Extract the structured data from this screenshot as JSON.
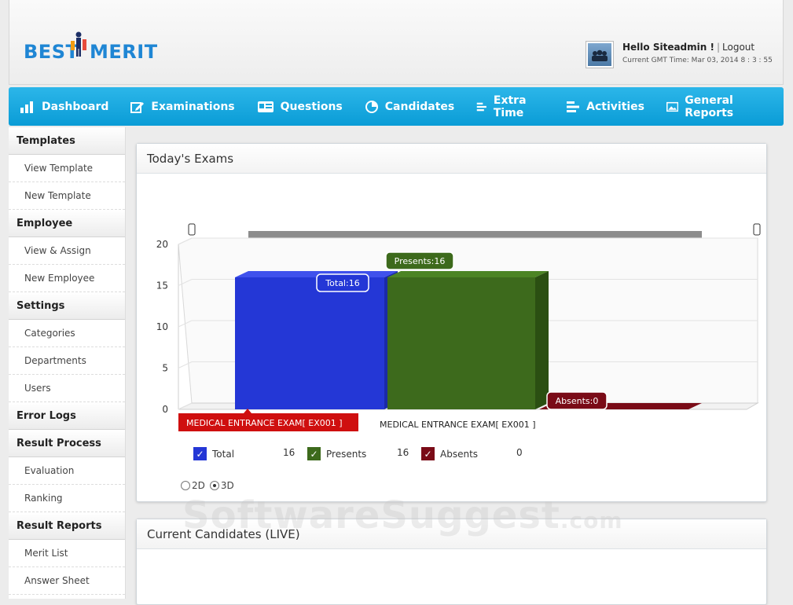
{
  "header": {
    "logo_left": "BEST",
    "logo_right": "MERIT",
    "greeting": "Hello Siteadmin !",
    "logout": "Logout",
    "gmt_time": "Current GMT Time: Mar 03, 2014   8 : 3 : 55"
  },
  "nav": {
    "items": [
      {
        "label": "Dashboard",
        "icon": "bar-chart-icon"
      },
      {
        "label": "Examinations",
        "icon": "edit-icon"
      },
      {
        "label": "Questions",
        "icon": "id-card-icon"
      },
      {
        "label": "Candidates",
        "icon": "pie-icon"
      },
      {
        "label": "Extra Time",
        "icon": "list-icon"
      },
      {
        "label": "Activities",
        "icon": "list-icon"
      },
      {
        "label": "General Reports",
        "icon": "image-icon"
      }
    ]
  },
  "sidebar": {
    "templates": "Templates",
    "view_template": "View Template",
    "new_template": "New Template",
    "employee": "Employee",
    "view_assign": "View & Assign",
    "new_employee": "New Employee",
    "settings": "Settings",
    "categories": "Categories",
    "departments": "Departments",
    "users": "Users",
    "error_logs": "Error Logs",
    "result_process": "Result Process",
    "evaluation": "Evaluation",
    "ranking": "Ranking",
    "result_reports": "Result Reports",
    "merit_list": "Merit List",
    "answer_sheet": "Answer Sheet"
  },
  "panels": {
    "todays_exams": "Today's Exams",
    "current_candidates": "Current Candidates (LIVE)"
  },
  "chart_data": {
    "type": "bar",
    "categories": [
      "MEDICAL ENTRANCE EXAM[ EX001 ]"
    ],
    "series": [
      {
        "name": "Total",
        "values": [
          16
        ],
        "color": "#2437d6"
      },
      {
        "name": "Presents",
        "values": [
          16
        ],
        "color": "#3d6a1c"
      },
      {
        "name": "Absents",
        "values": [
          0
        ],
        "color": "#7a0b17"
      }
    ],
    "ylim": [
      0,
      20
    ],
    "yticks": [
      0,
      5,
      10,
      15,
      20
    ],
    "ytick_labels": [
      "0",
      "5",
      "10",
      "15",
      "20"
    ],
    "tooltips": [
      "Total:16",
      "Presents:16",
      "Absents:0"
    ],
    "x_label_active": "MEDICAL ENTRANCE EXAM[ EX001 ]",
    "x_label": "MEDICAL ENTRANCE EXAM[ EX001 ]",
    "grid": true,
    "legend_placement": "bottom"
  },
  "legend": {
    "items": [
      {
        "label": "Total",
        "value": "16"
      },
      {
        "label": "Presents",
        "value": "16"
      },
      {
        "label": "Absents",
        "value": "0"
      }
    ]
  },
  "view_mode": {
    "opt_2d": "2D",
    "opt_3d": "3D",
    "selected": "3D"
  },
  "watermark": {
    "text": "SoftwareSuggest",
    "suffix": ".com"
  }
}
